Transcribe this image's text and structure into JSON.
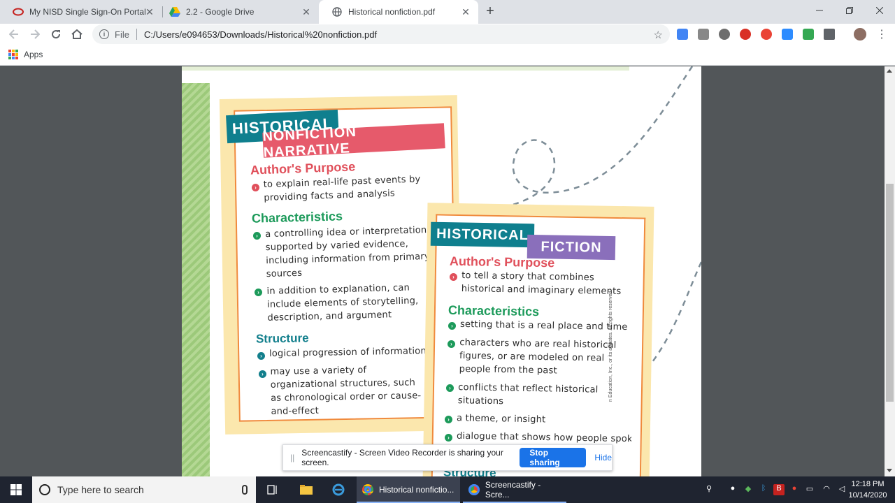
{
  "browser": {
    "tabs": [
      {
        "title": "My NISD Single Sign-On Portal",
        "active": false
      },
      {
        "title": "2.2 - Google Drive",
        "active": false
      },
      {
        "title": "Historical nonfiction.pdf",
        "active": true
      }
    ],
    "url_label": "File",
    "url": "C:/Users/e094653/Downloads/Historical%20nonfiction.pdf",
    "bookmarks": {
      "apps_label": "Apps"
    }
  },
  "pdf": {
    "card1": {
      "banner_top": "HISTORICAL",
      "banner_bottom": "NONFICTION NARRATIVE",
      "purpose_heading": "Author's Purpose",
      "purpose_items": [
        "to explain real-life past events by providing facts and analysis"
      ],
      "characteristics_heading": "Characteristics",
      "characteristics_items": [
        "a controlling idea or interpretation supported by varied evidence, including information from primary sources",
        "in addition to explanation, can include elements of storytelling, description, and argument"
      ],
      "structure_heading": "Structure",
      "structure_items": [
        "logical progression of information",
        "may use a variety of organizational structures, such as chronological order or cause-and-effect"
      ]
    },
    "card2": {
      "banner_top": "HISTORICAL",
      "banner_bottom": "FICTION",
      "purpose_heading": "Author's Purpose",
      "purpose_items": [
        "to tell a story that combines historical and imaginary elements"
      ],
      "characteristics_heading": "Characteristics",
      "characteristics_items": [
        "setting that is a real place and time",
        "characters who are real historical figures, or are modeled on real people from the past",
        "conflicts that reflect historical situations",
        "a theme, or insight",
        "dialogue that shows how people spoke"
      ],
      "structure_heading": "Structure"
    },
    "copyright": "n Education, Inc., or its affiliates. All rights reserved."
  },
  "screencastify": {
    "message": "Screencastify - Screen Video Recorder is sharing your screen.",
    "stop_label": "Stop sharing",
    "hide_label": "Hide"
  },
  "taskbar": {
    "search_placeholder": "Type here to search",
    "tasks": [
      {
        "label": "Historical nonfictio...",
        "active": true
      },
      {
        "label": "Screencastify - Scre...",
        "active": false
      }
    ],
    "time": "12:18 PM",
    "date": "10/14/2020"
  },
  "colors": {
    "banner_teal": "#0f7f8e",
    "banner_pink": "#e65a6b",
    "banner_purple": "#8a6fbb",
    "card_frame": "#fbe7ad",
    "frame_line": "#f08a3c",
    "green_strip": "#9cc97a"
  }
}
